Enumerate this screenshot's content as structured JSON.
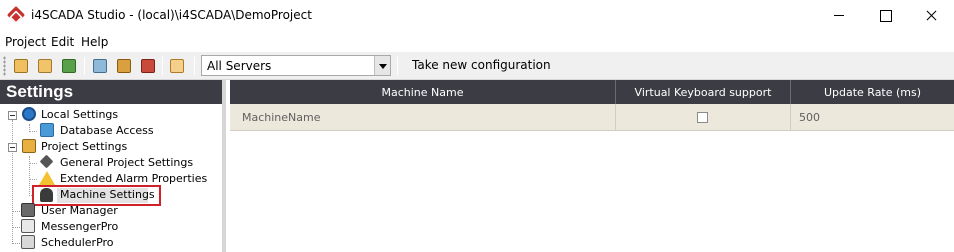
{
  "window": {
    "title": "i4SCADA Studio - (local)\\i4SCADA\\DemoProject"
  },
  "menu": {
    "project": "Project",
    "edit": "Edit",
    "help": "Help"
  },
  "toolbar": {
    "server_value": "All Servers",
    "take_config_label": "Take new configuration"
  },
  "settings": {
    "header": "Settings",
    "tree": {
      "local_settings": "Local Settings",
      "database_access": "Database Access",
      "project_settings": "Project Settings",
      "general_project_settings": "General Project Settings",
      "extended_alarm_properties": "Extended Alarm Properties",
      "machine_settings": "Machine Settings",
      "user_manager": "User Manager",
      "messenger_pro": "MessengerPro",
      "scheduler_pro": "SchedulerPro"
    }
  },
  "grid": {
    "columns": [
      "Machine Name",
      "Virtual Keyboard support",
      "Update Rate (ms)"
    ],
    "rows": [
      {
        "machine_name": "MachineName",
        "virtual_keyboard": false,
        "update_rate": "500"
      }
    ]
  },
  "colors": {
    "header_bg": "#3c3c45",
    "row_bg": "#ece8dc",
    "selection_outline": "#d0202a",
    "brand": "#c8332f"
  }
}
